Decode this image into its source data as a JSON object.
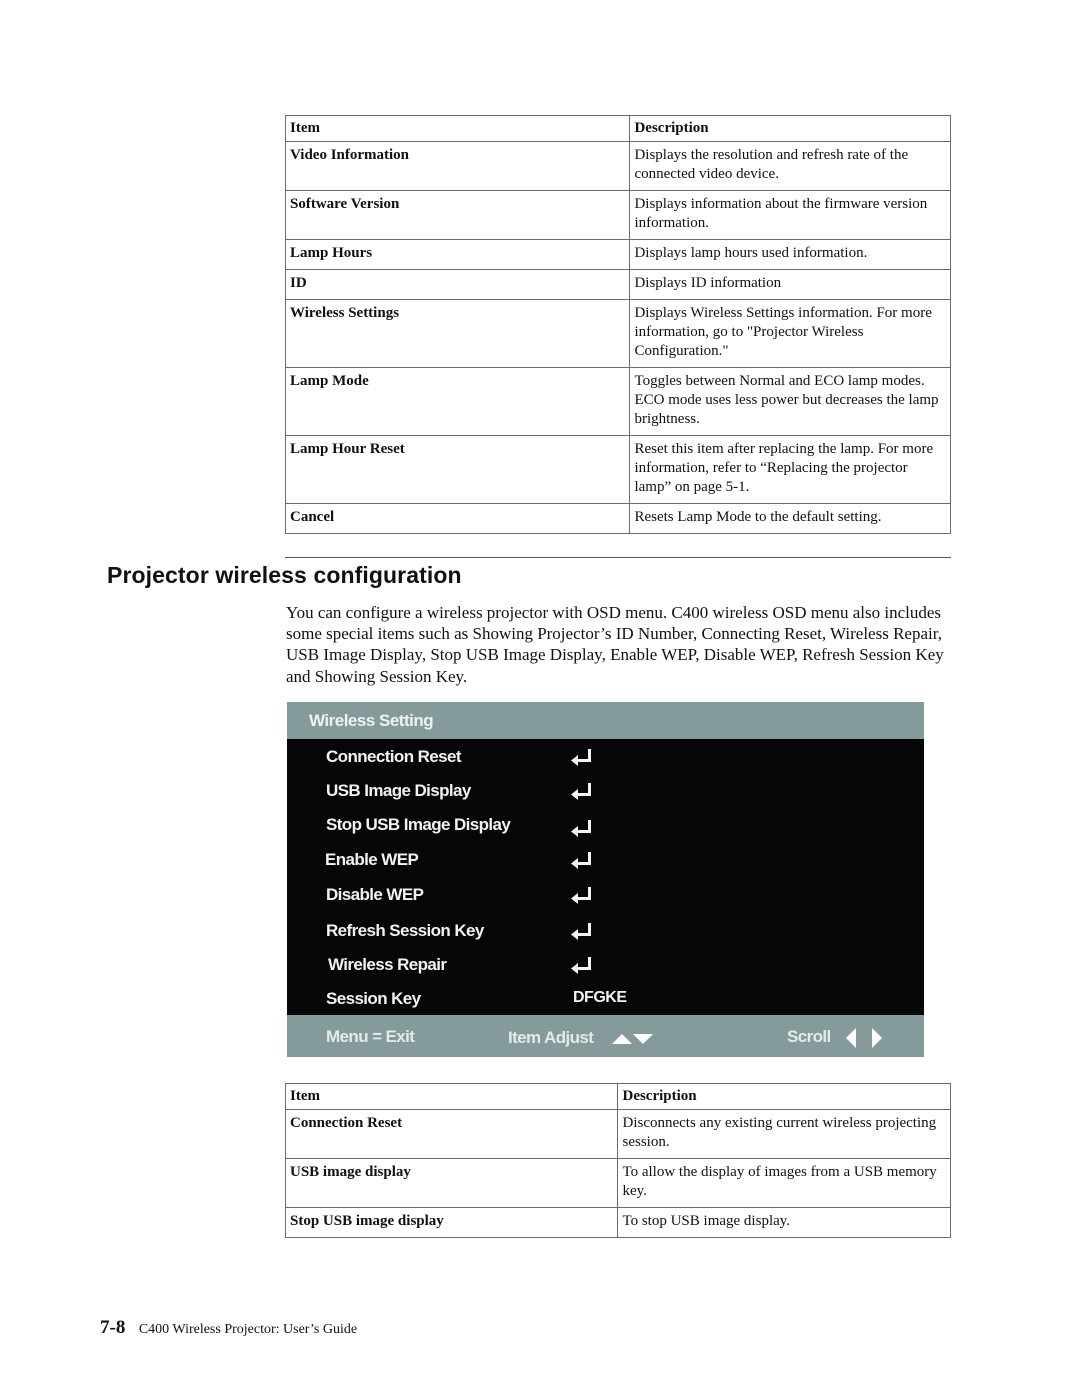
{
  "table1": {
    "headers": [
      "Item",
      "Description"
    ],
    "rows": [
      {
        "item": "Video Information",
        "description": "Displays the resolution and refresh rate of the connected video device."
      },
      {
        "item": "Software Version",
        "description": "Displays information about the firmware version information."
      },
      {
        "item": "Lamp Hours",
        "description": "Displays lamp hours used information."
      },
      {
        "item": "ID",
        "description": "Displays ID information"
      },
      {
        "item": "Wireless Settings",
        "description": "Displays Wireless Settings information. For more information, go to \"Projector Wireless Configuration.\""
      },
      {
        "item": "Lamp Mode",
        "description": "Toggles between Normal and ECO lamp modes. ECO mode uses less power but decreases the lamp brightness."
      },
      {
        "item": "Lamp Hour Reset",
        "description": "Reset this item after replacing the lamp. For more information, refer to “Replacing the projector lamp” on page 5-1."
      },
      {
        "item": "Cancel",
        "description": "Resets Lamp Mode to the default setting."
      }
    ]
  },
  "section": {
    "title": "Projector wireless configuration",
    "intro": "You can configure a wireless projector with OSD menu. C400 wireless OSD menu also includes some special items such as Showing Projector’s ID Number, Connecting Reset, Wireless Repair, USB Image Display, Stop USB Image Display, Enable WEP, Disable WEP, Refresh Session Key and Showing Session Key."
  },
  "osd": {
    "title": "Wireless Setting",
    "items": [
      {
        "label": "Connection Reset",
        "icon": "enter-icon"
      },
      {
        "label": "USB Image Display",
        "icon": "enter-icon"
      },
      {
        "label": "Stop USB Image Display",
        "icon": "enter-icon"
      },
      {
        "label": "Enable WEP",
        "icon": "enter-icon"
      },
      {
        "label": "Disable WEP",
        "icon": "enter-icon"
      },
      {
        "label": "Refresh Session Key",
        "icon": "enter-icon"
      },
      {
        "label": "Wireless Repair",
        "icon": "enter-icon"
      },
      {
        "label": "Session Key",
        "value": "DFGKE"
      }
    ],
    "footer": {
      "menu_exit": "Menu = Exit",
      "item_adjust": "Item Adjust",
      "scroll": "Scroll"
    },
    "colors": {
      "bar": "#859b9b",
      "body": "#050607",
      "text": "#f2f2f2"
    }
  },
  "table2": {
    "headers": [
      "Item",
      "Description"
    ],
    "rows": [
      {
        "item": "Connection Reset",
        "description": "Disconnects any existing current wireless projecting session."
      },
      {
        "item": "USB image display",
        "description": "To allow the display of images from a USB memory key."
      },
      {
        "item": "Stop USB image display",
        "description": "To stop USB image display."
      }
    ]
  },
  "page_footer": {
    "page_number": "7-8",
    "guide_title": "C400 Wireless Projector: User’s Guide"
  }
}
